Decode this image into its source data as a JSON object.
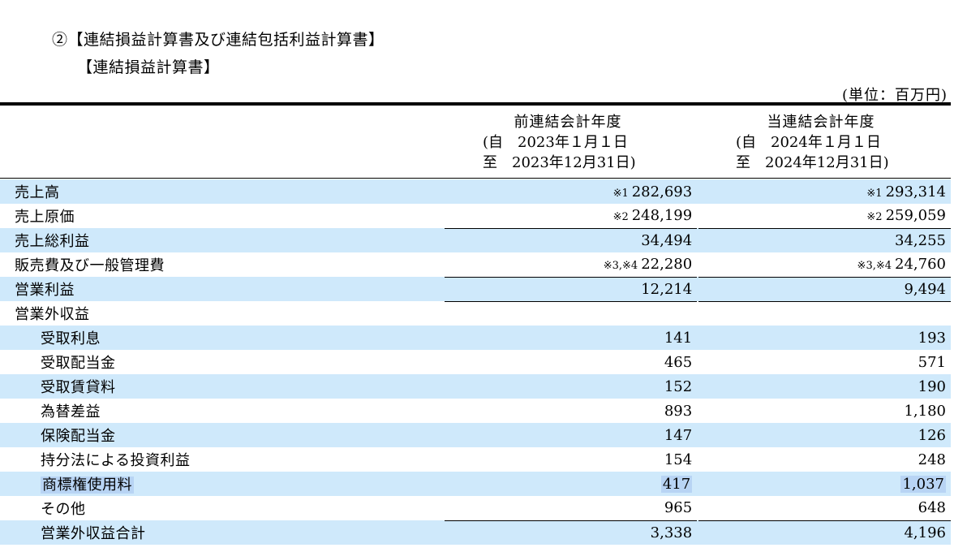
{
  "heading": "②【連結損益計算書及び連結包括利益計算書】",
  "subheading": "【連結損益計算書】",
  "unit": "(単位：百万円)",
  "columns": [
    {
      "title": "前連結会計年度",
      "line2": "(自　2023年１月１日",
      "line3": "至　2023年12月31日)"
    },
    {
      "title": "当連結会計年度",
      "line2": "(自　2024年１月１日",
      "line3": "至　2024年12月31日)"
    }
  ],
  "rows": [
    {
      "label": "売上高",
      "note1": "※1",
      "v1": "282,693",
      "note2": "※1",
      "v2": "293,314"
    },
    {
      "label": "売上原価",
      "note1": "※2",
      "v1": "248,199",
      "note2": "※2",
      "v2": "259,059"
    },
    {
      "label": "売上総利益",
      "note1": "",
      "v1": "34,494",
      "note2": "",
      "v2": "34,255"
    },
    {
      "label": "販売費及び一般管理費",
      "note1": "※3,※4",
      "v1": "22,280",
      "note2": "※3,※4",
      "v2": "24,760"
    },
    {
      "label": "営業利益",
      "note1": "",
      "v1": "12,214",
      "note2": "",
      "v2": "9,494"
    },
    {
      "label": "営業外収益",
      "note1": "",
      "v1": "",
      "note2": "",
      "v2": ""
    },
    {
      "label": "受取利息",
      "note1": "",
      "v1": "141",
      "note2": "",
      "v2": "193"
    },
    {
      "label": "受取配当金",
      "note1": "",
      "v1": "465",
      "note2": "",
      "v2": "571"
    },
    {
      "label": "受取賃貸料",
      "note1": "",
      "v1": "152",
      "note2": "",
      "v2": "190"
    },
    {
      "label": "為替差益",
      "note1": "",
      "v1": "893",
      "note2": "",
      "v2": "1,180"
    },
    {
      "label": "保険配当金",
      "note1": "",
      "v1": "147",
      "note2": "",
      "v2": "126"
    },
    {
      "label": "持分法による投資利益",
      "note1": "",
      "v1": "154",
      "note2": "",
      "v2": "248"
    },
    {
      "label": "商標権使用料",
      "note1": "",
      "v1": "417",
      "note2": "",
      "v2": "1,037"
    },
    {
      "label": "その他",
      "note1": "",
      "v1": "965",
      "note2": "",
      "v2": "648"
    },
    {
      "label": "営業外収益合計",
      "note1": "",
      "v1": "3,338",
      "note2": "",
      "v2": "4,196"
    }
  ]
}
